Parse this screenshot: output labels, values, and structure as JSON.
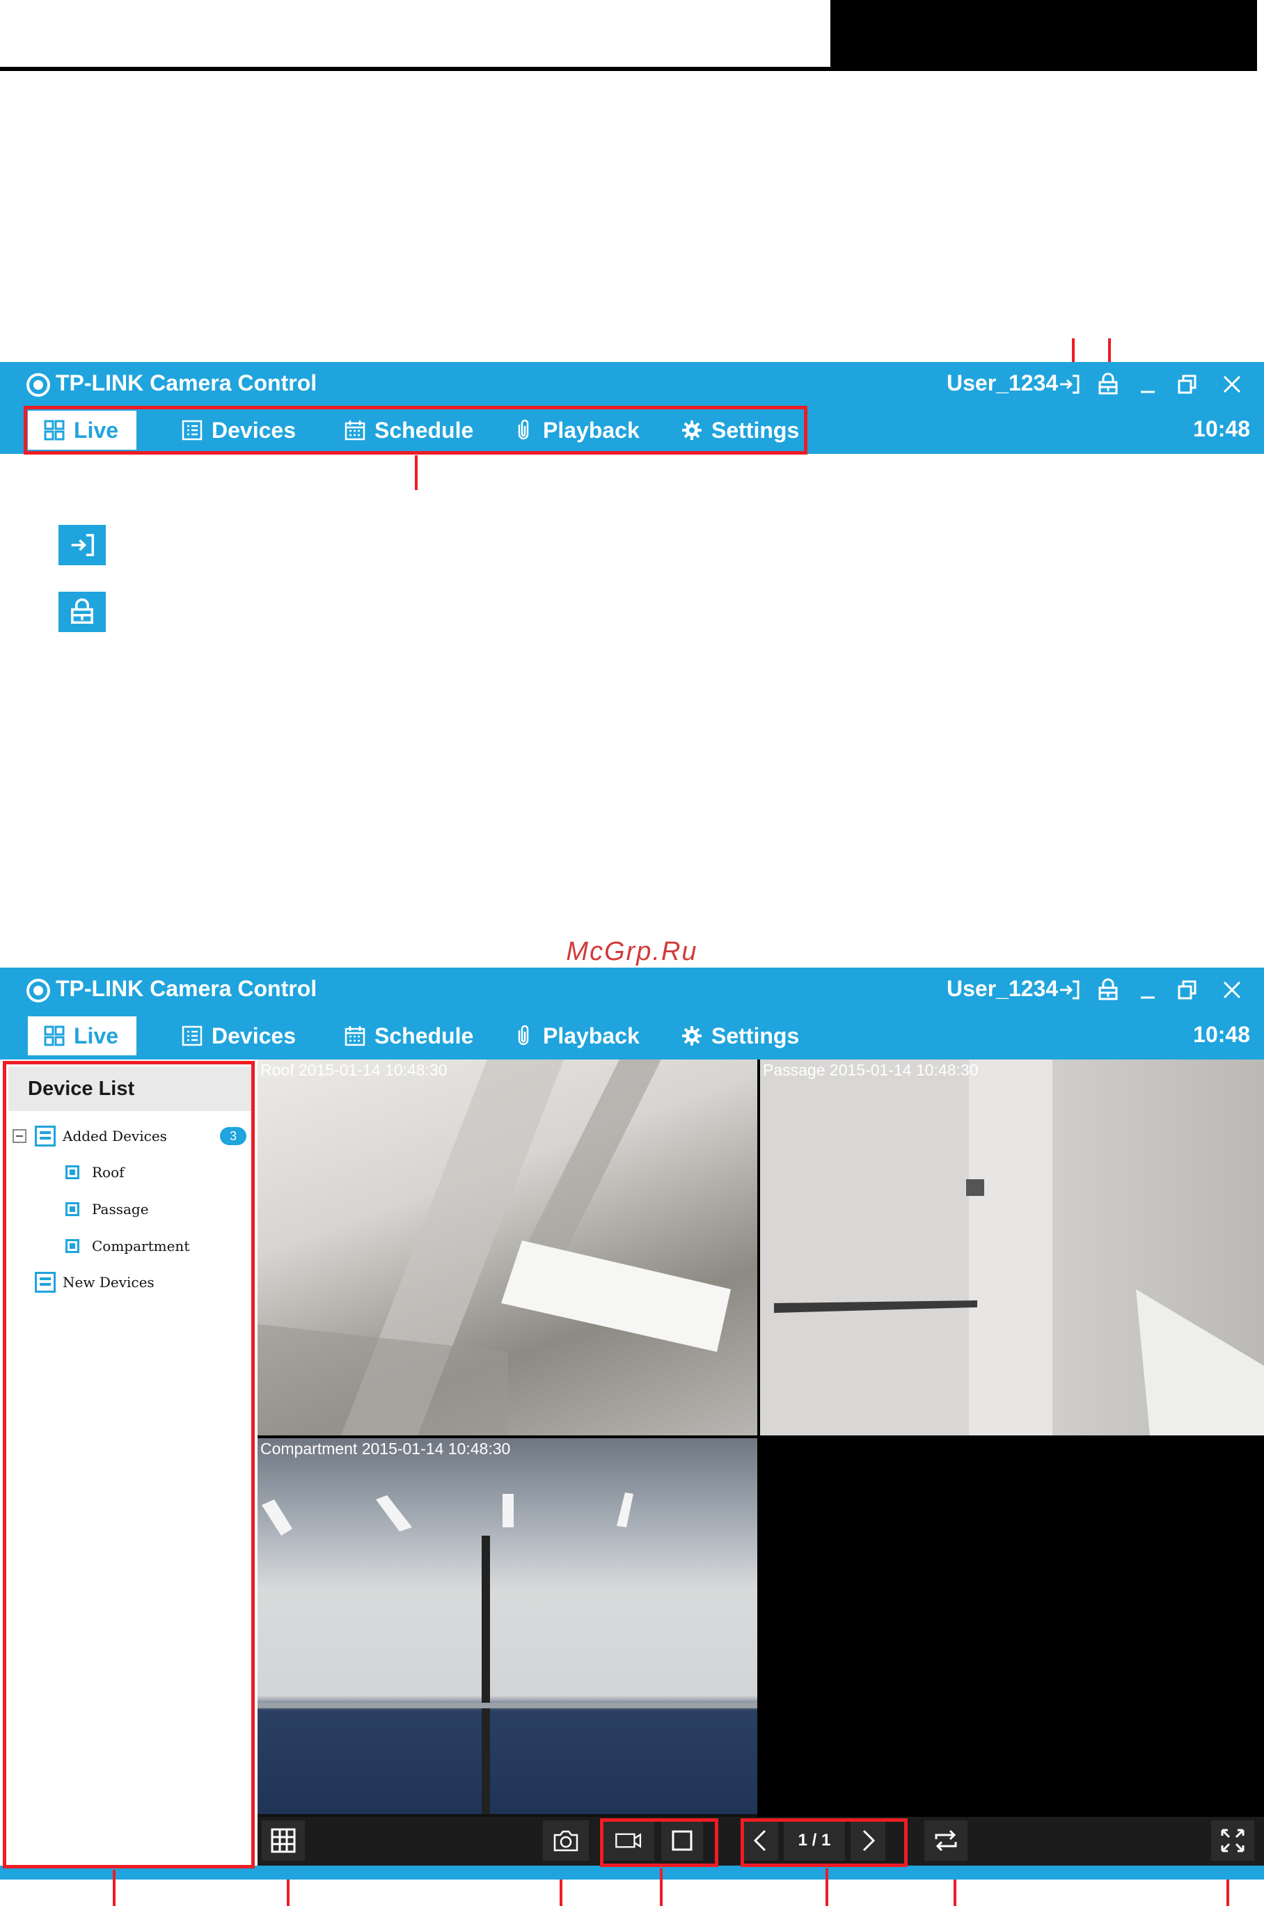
{
  "app": {
    "title": "TP-LINK Camera Control",
    "user": "User_1234",
    "time": "10:48",
    "tabs": [
      {
        "label": "Live",
        "icon": "grid-icon"
      },
      {
        "label": "Devices",
        "icon": "list-icon"
      },
      {
        "label": "Schedule",
        "icon": "calendar-icon"
      },
      {
        "label": "Playback",
        "icon": "clip-icon"
      },
      {
        "label": "Settings",
        "icon": "gear-icon"
      }
    ],
    "window_controls": [
      "logout-icon",
      "lock-icon",
      "minimize-icon",
      "restore-icon",
      "close-icon"
    ]
  },
  "watermark": "McGrp.Ru",
  "live": {
    "device_list_title": "Device List",
    "tree": {
      "added_label": "Added Devices",
      "added_count": "3",
      "devices": [
        "Roof",
        "Passage",
        "Compartment"
      ],
      "new_label": "New Devices"
    },
    "cameras": [
      {
        "name": "Roof",
        "timestamp": "2015-01-14 10:48:30"
      },
      {
        "name": "Passage",
        "timestamp": "2015-01-14 10:48:30"
      },
      {
        "name": "Compartment",
        "timestamp": "2015-01-14 10:48:30"
      }
    ],
    "page_indicator": "1 / 1",
    "toolbar_icons": [
      "layout-grid-icon",
      "snapshot-camera-icon",
      "record-video-icon",
      "stop-icon",
      "prev-page-icon",
      "next-page-icon",
      "cycle-icon",
      "fullscreen-icon"
    ]
  },
  "colors": {
    "accent": "#1fa4dd",
    "highlight": "#ee1c25"
  }
}
